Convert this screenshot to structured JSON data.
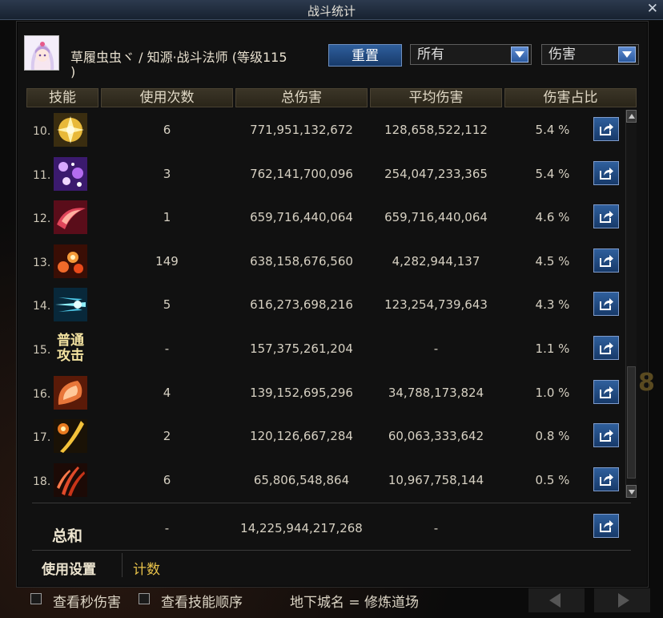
{
  "window": {
    "title": "战斗统计",
    "close_glyph": "✕"
  },
  "header": {
    "player_name_line1": "草履虫虫ヾ / 知源·战斗法师 (等级115",
    "player_name_line2": ")",
    "reset_label": "重置",
    "filter_select": "所有",
    "type_select": "伤害"
  },
  "columns": {
    "skill": "技能",
    "uses": "使用次数",
    "total": "总伤害",
    "avg": "平均伤害",
    "share": "伤害占比"
  },
  "rows": [
    {
      "index": "10.",
      "icon": "golden-burst-skill-icon",
      "uses": "6",
      "total": "771,951,132,672",
      "avg": "128,658,522,112",
      "share": "5.4 %"
    },
    {
      "index": "11.",
      "icon": "purple-sparkle-skill-icon",
      "uses": "3",
      "total": "762,141,700,096",
      "avg": "254,047,233,365",
      "share": "5.4 %"
    },
    {
      "index": "12.",
      "icon": "crimson-sweep-skill-icon",
      "uses": "1",
      "total": "659,716,440,064",
      "avg": "659,716,440,064",
      "share": "4.6 %"
    },
    {
      "index": "13.",
      "icon": "fire-orbs-skill-icon",
      "uses": "149",
      "total": "638,158,676,560",
      "avg": "4,282,944,137",
      "share": "4.5 %"
    },
    {
      "index": "14.",
      "icon": "cyan-dash-skill-icon",
      "uses": "5",
      "total": "616,273,698,216",
      "avg": "123,254,739,643",
      "share": "4.3 %"
    },
    {
      "index": "15.",
      "icon": "normal-attack-text-icon",
      "icon_text": "普通攻击",
      "uses": "-",
      "total": "157,375,261,204",
      "avg": "-",
      "share": "1.1 %"
    },
    {
      "index": "16.",
      "icon": "flame-fist-skill-icon",
      "uses": "4",
      "total": "139,152,695,296",
      "avg": "34,788,173,824",
      "share": "1.0 %"
    },
    {
      "index": "17.",
      "icon": "golden-slash-skill-icon",
      "uses": "2",
      "total": "120,126,667,284",
      "avg": "60,063,333,642",
      "share": "0.8 %"
    },
    {
      "index": "18.",
      "icon": "claw-slash-skill-icon",
      "uses": "6",
      "total": "65,806,548,864",
      "avg": "10,967,758,144",
      "share": "0.5 %"
    }
  ],
  "total": {
    "label": "总和",
    "uses": "-",
    "total": "14,225,944,217,268",
    "avg": "-"
  },
  "tabs": {
    "settings": "使用设置",
    "count": "计数"
  },
  "bottom": {
    "check_per_second": "查看秒伤害",
    "check_skill_order": "查看技能顺序",
    "dungeon": "地下城名 = 修炼道场"
  },
  "colors": {
    "accent_blue": "#2f5f9c",
    "gold_text": "#e8c24a"
  }
}
